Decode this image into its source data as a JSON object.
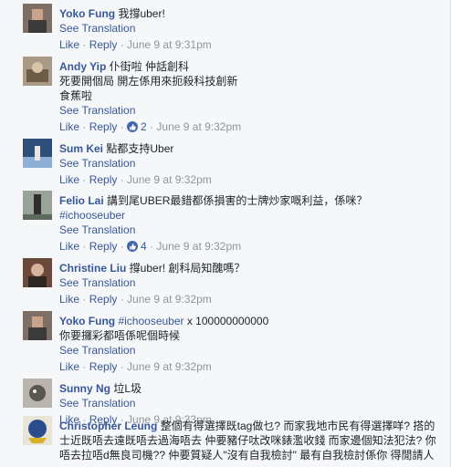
{
  "comments": [
    {
      "author": "Yoko Fung",
      "text": [
        " 我撐uber!"
      ],
      "see_translation": "See Translation",
      "like": "Like",
      "reply": "Reply",
      "likes": "",
      "time": "June 9 at 9:31pm"
    },
    {
      "author": "Andy Yip",
      "text": [
        " 仆街啦 仲話創科",
        "死要開個局 開左係用來扼殺科技創新",
        "食蕉啦"
      ],
      "see_translation": "See Translation",
      "like": "Like",
      "reply": "Reply",
      "likes": "2",
      "time": "June 9 at 9:32pm"
    },
    {
      "author": "Sum Kei",
      "text": [
        " 點都支持Uber"
      ],
      "see_translation": "See Translation",
      "like": "Like",
      "reply": "Reply",
      "likes": "",
      "time": "June 9 at 9:32pm"
    },
    {
      "author": "Felio Lai",
      "text": [
        " 講到尾UBER最錯都係損害的士牌炒家嘅利益，係咪？"
      ],
      "hashtag": "#ichooseuber",
      "see_translation": "See Translation",
      "like": "Like",
      "reply": "Reply",
      "likes": "4",
      "time": "June 9 at 9:32pm"
    },
    {
      "author": "Christine Liu",
      "text": [
        " 撐uber! 創科局知醜嗎？"
      ],
      "see_translation": "See Translation",
      "like": "Like",
      "reply": "Reply",
      "likes": "",
      "time": "June 9 at 9:32pm"
    },
    {
      "author": "Yoko Fung",
      "hashtag_inline": "#ichooseuber",
      "text_after": " x 100000000000",
      "text2": "你要攞彩都唔係呢個時候",
      "see_translation": "See Translation",
      "like": "Like",
      "reply": "Reply",
      "likes": "",
      "time": "June 9 at 9:32pm"
    },
    {
      "author": "Sunny Ng",
      "text": [
        " 垃L圾"
      ],
      "see_translation": "See Translation",
      "like": "Like",
      "reply": "Reply",
      "likes": "",
      "time": "June 9 at 9:33pm"
    },
    {
      "author": "Christopher Leung",
      "text_long": " 整個有得選擇既tag做乜? 而家我地市民有得選擇咩? 搭的士近既唔去遠既唔去過海唔去 仲要豬仔呔改咪錶濫收錢 而家邊個知法犯法? 你唔去拉唔d無良司機?? 仲要質疑人\"沒有自我檢討\" 最有自我檢討係你 得閒請人"
    }
  ],
  "separator": " · "
}
